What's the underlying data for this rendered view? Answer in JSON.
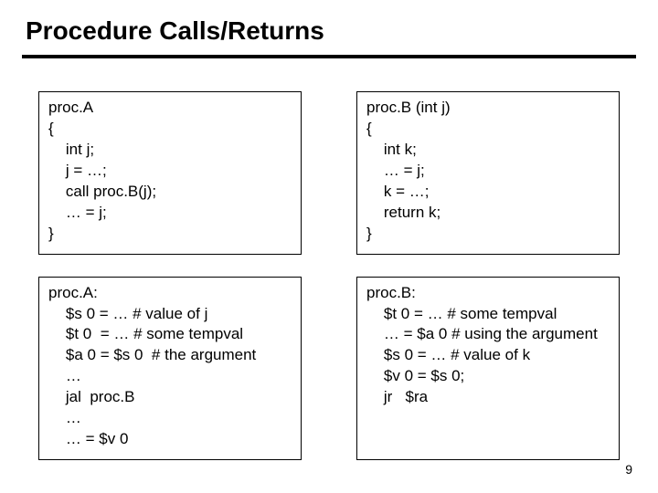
{
  "title": "Procedure Calls/Returns",
  "page_number": "9",
  "box_tl": "proc.A\n{\n    int j;\n    j = …;\n    call proc.B(j);\n    … = j;\n}",
  "box_tr": "proc.B (int j)\n{\n    int k;\n    … = j;\n    k = …;\n    return k;\n}",
  "box_bl": "proc.A:\n    $s 0 = … # value of j\n    $t 0  = … # some tempval\n    $a 0 = $s 0  # the argument\n    …\n    jal  proc.B\n    …\n    … = $v 0",
  "box_br": "proc.B:\n    $t 0 = … # some tempval\n    … = $a 0 # using the argument\n    $s 0 = … # value of k\n    $v 0 = $s 0;\n    jr   $ra"
}
